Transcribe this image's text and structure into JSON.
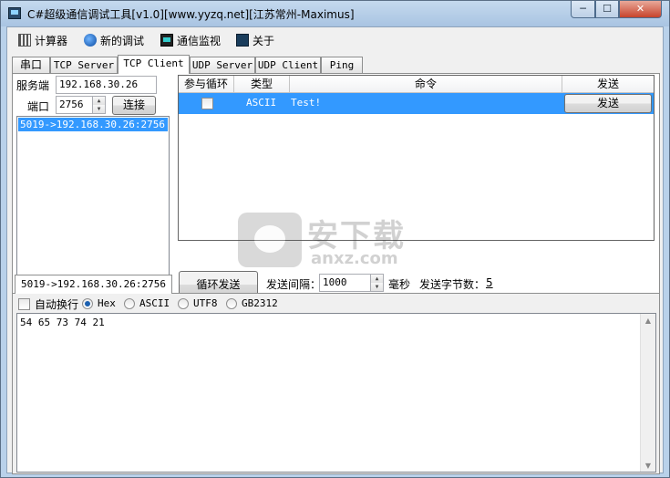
{
  "window": {
    "title": "C#超级通信调试工具[v1.0][www.yyzq.net][江苏常州-Maximus]",
    "minimize_glyph": "─",
    "maximize_glyph": "☐",
    "close_glyph": "✕"
  },
  "toolbar": {
    "items": [
      {
        "label": "计算器",
        "icon": "calculator-icon"
      },
      {
        "label": "新的调试",
        "icon": "new-debug-icon"
      },
      {
        "label": "通信监视",
        "icon": "monitor-icon"
      },
      {
        "label": "关于",
        "icon": "about-icon"
      }
    ]
  },
  "tabs": [
    "串口",
    "TCP Server",
    "TCP Client",
    "UDP Server",
    "UDP Client",
    "Ping"
  ],
  "active_tab": "TCP Client",
  "client": {
    "server_label": "服务端",
    "server_value": "192.168.30.26",
    "port_label": "端口",
    "port_value": "2756",
    "connect_button": "连接",
    "connections": [
      "5019->192.168.30.26:2756"
    ]
  },
  "grid": {
    "headers": [
      "参与循环",
      "类型",
      "命令",
      "发送"
    ],
    "rows": [
      {
        "loop": false,
        "type": "ASCII",
        "command": "Test!",
        "send_label": "发送"
      }
    ]
  },
  "loop": {
    "loop_send_button": "循环发送",
    "interval_label": "发送间隔：",
    "interval_value": "1000",
    "unit_label": "毫秒",
    "bytes_label": "发送字节数：",
    "bytes_value": "5"
  },
  "receive": {
    "tab_label": "5019->192.168.30.26:2756",
    "auto_wrap_label": "自动换行",
    "encodings": [
      "Hex",
      "ASCII",
      "UTF8",
      "GB2312"
    ],
    "selected_encoding": "Hex",
    "content": "54 65 73 74 21"
  },
  "watermark": {
    "text_cn": "安下载",
    "text_en": "anxz.com"
  },
  "colors": {
    "selection": "#3399ff",
    "titlebar": "#b9d1ea"
  }
}
